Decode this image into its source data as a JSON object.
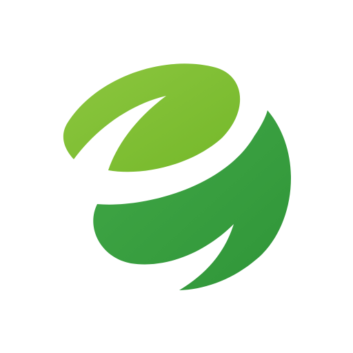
{
  "colors": {
    "background": "#ffffff",
    "leaf_light": "#7cbd2c",
    "leaf_dark": "#369a3e"
  },
  "icon": {
    "name": "green-leaf-logo-icon"
  }
}
